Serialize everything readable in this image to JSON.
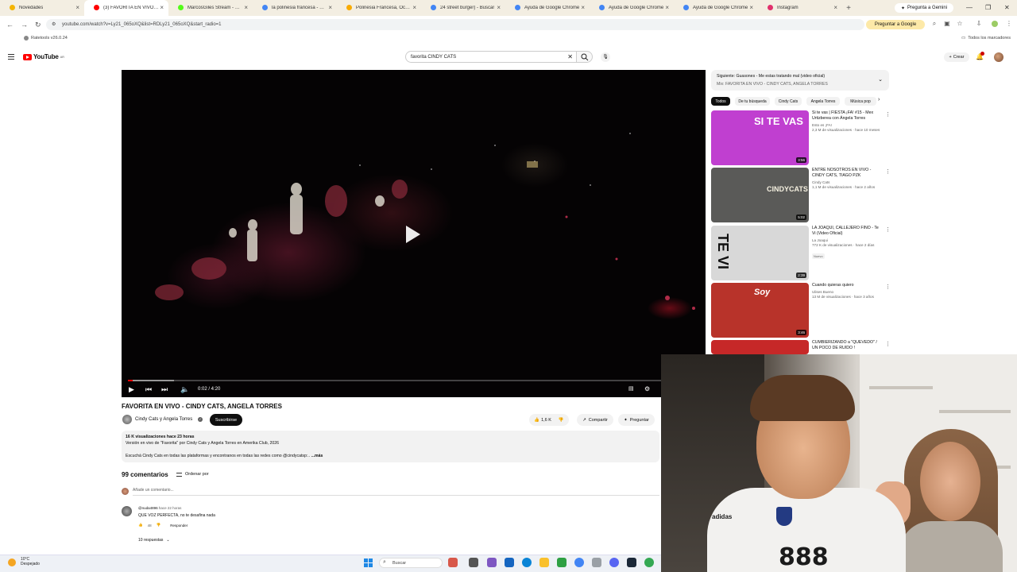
{
  "browser": {
    "tabs": [
      {
        "label": "Novedades",
        "color": "#f4b400"
      },
      {
        "label": "(3) FAVORITA EN VIVO - CI",
        "color": "#ff0000"
      },
      {
        "label": "MarcosGiles Stream - Wat",
        "color": "#53fc18"
      },
      {
        "label": "la polinesia francesa - Bus",
        "color": "#4285f4"
      },
      {
        "label": "Polinesia Francesa, Ocean",
        "color": "#f9ab00"
      },
      {
        "label": "24 street burger) - Buscar",
        "color": "#4285f4"
      },
      {
        "label": "Ayuda de Google Chrome",
        "color": "#4285f4"
      },
      {
        "label": "Ayuda de Google Chrome",
        "color": "#4285f4"
      },
      {
        "label": "Ayuda de Google Chrome",
        "color": "#4285f4"
      },
      {
        "label": "Instagram",
        "color": "#e1306c"
      }
    ],
    "new_tab": "+",
    "gemini_label": "Pregunta a Gemini",
    "url": "youtube.com/watch?v=Ly21_065oXQ&list=RDLy21_065oXQ&start_radio=1",
    "ask_google": "Preguntar a Google",
    "bookmark_left": "Ratetools v26.0.24",
    "bookmark_right": "Todos los marcadores",
    "window_min": "—",
    "window_max": "❐",
    "window_close": "✕"
  },
  "youtube": {
    "logo_text": "YouTube",
    "logo_region": "AR",
    "search_value": "favorita CINDY CATS",
    "create_label": "Crear",
    "icons": {
      "menu": "hamburger-icon",
      "search": "search-icon",
      "mic": "mic-icon",
      "bell": "bell-icon"
    }
  },
  "player": {
    "time": "0:02 / 4:20",
    "progress_fraction": 0.008,
    "buffer_fraction": 0.08
  },
  "video": {
    "title": "FAVORITA EN VIVO - CINDY CATS, ANGELA TORRES",
    "channel": "Cindy Cats y Angela Torres",
    "subscribe": "Suscribirse",
    "likes": "1,6 K",
    "share": "Compartir",
    "ask": "Preguntar",
    "description": {
      "line1": "16 K visualizaciones  hace 23 horas",
      "line2": "Versión en vivo de \"Favorita\" por Cindy Cats y Angela Torres en Amerika Club, 2026",
      "line3": "Escuchá Cindy Cats en todas las plataformas y encontranos en todas las redes como @cindycatsp:..",
      "more": "...más"
    }
  },
  "comments": {
    "count": "99 comentarios",
    "sort": "Ordenar por",
    "add_placeholder": "Añade un comentario...",
    "first": {
      "author": "@nuda4896",
      "ago": "hace 22 horas",
      "text": "QUE VOZ PERFECTA, no te desafina nada",
      "likes": "48",
      "reply": "Responder",
      "replies": "10 respuestas"
    }
  },
  "sidebar": {
    "next_up": "Siguiente: Guasones - Me estas tratando mal (video oficial)",
    "mix": "Mix: FAVORITA EN VIVO - CINDY CATS, ANGELA TORRES",
    "chips": [
      "Todos",
      "De tu búsqueda",
      "Cindy Cats",
      "Angela Torres",
      "Música pop"
    ],
    "videos": [
      {
        "title": "Si te vas | FIESTA ¡FA! #15 - Mex Urtizberea con Ángela Torres",
        "channel": "Esto es ¡FA!",
        "stats": "2,3 M de visualizaciones · hace 10 meses",
        "duration": "3:56",
        "thumb_text": "SI TE VAS",
        "thumb_color": "#c03fd0"
      },
      {
        "title": "ENTRE NOSOTROS EN VIVO - CINDY CATS, TIAGO PZK",
        "channel": "Cindy Cats",
        "stats": "1,1 M de visualizaciones · hace 2 años",
        "duration": "5:02",
        "thumb_text": "CINDYCATS",
        "thumb_color": "#5a5a58"
      },
      {
        "title": "LA JOAQUI, CALLEJERO FINO - Te Vi (Video Oficial)",
        "channel": "La Joaqui",
        "stats": "772 K de visualizaciones · hace 2 días",
        "duration": "2:39",
        "thumb_text": "TE VI",
        "thumb_color": "#d8d8d8",
        "badge": "Nuevo"
      },
      {
        "title": "Cuando quieras quiero",
        "channel": "Ulises Bueno",
        "stats": "13 M de visualizaciones · hace 3 años",
        "duration": "3:46",
        "thumb_text": "Soy",
        "thumb_color": "#b8332a"
      },
      {
        "title": "CUMBIERIZANDO a \"QUEVEDO\" / UN POCO DE RUIDO !",
        "channel": "",
        "stats": "",
        "duration": "",
        "thumb_text": "",
        "thumb_color": "#c62828"
      }
    ]
  },
  "webcam": {
    "jersey_number": "888",
    "jersey_brand": "adidas"
  },
  "taskbar": {
    "temp": "10°C",
    "weather": "Despejado",
    "search": "Buscar"
  }
}
